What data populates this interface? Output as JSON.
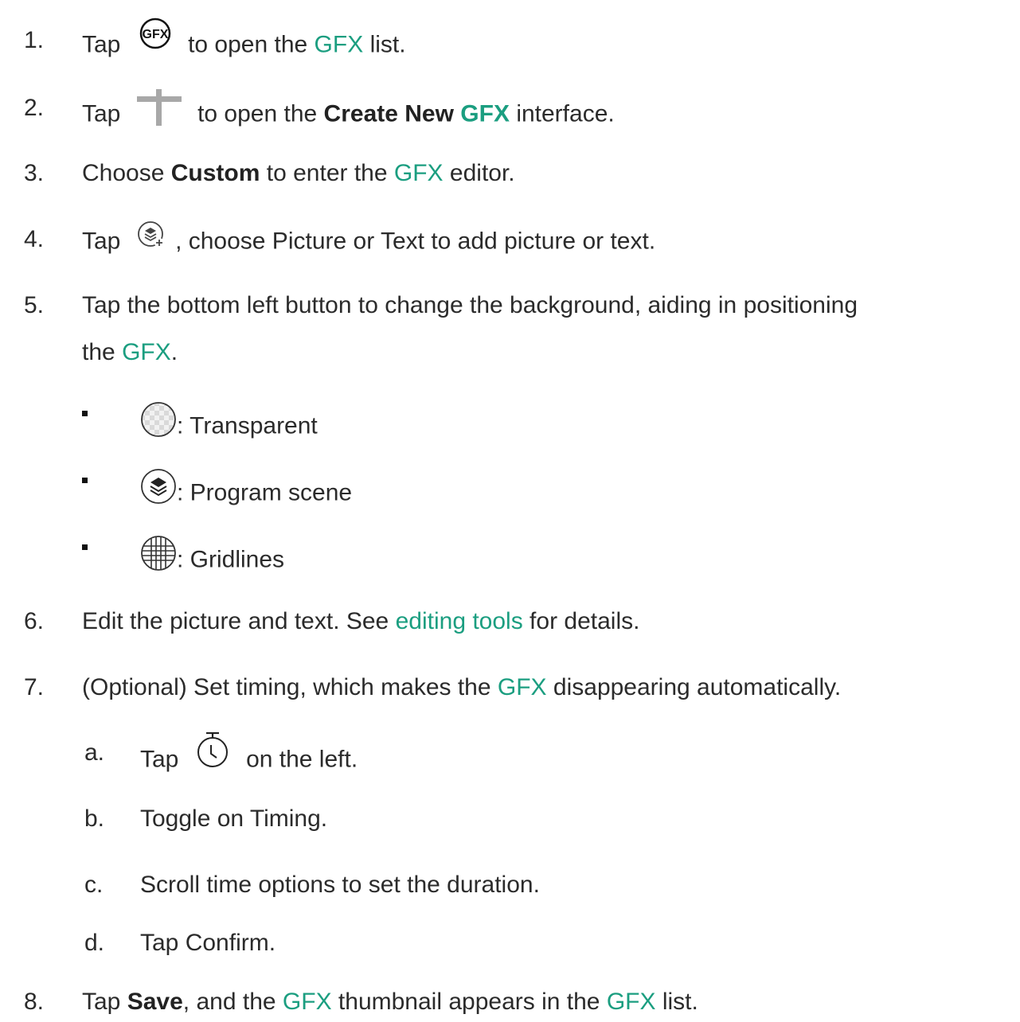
{
  "steps": {
    "s1": {
      "num": "1.",
      "a": "Tap",
      "b": "to open the",
      "link": "GFX",
      "c": "list.",
      "icon": "gfx-icon"
    },
    "s2": {
      "num": "2.",
      "a": "Tap",
      "b": "to open the",
      "bold": "Create New",
      "greenbold": "GFX",
      "c": "interface.",
      "icon": "plus-icon"
    },
    "s3": {
      "num": "3.",
      "a": "Choose",
      "bold": "Custom",
      "b": "to enter the",
      "link": "GFX",
      "c": "editor."
    },
    "s4": {
      "num": "4.",
      "a": "Tap",
      "b": ", choose Picture or Text to add picture or text.",
      "icon": "add-layer-icon"
    },
    "s5": {
      "num": "5.",
      "a": "Tap the bottom left button to change the background, aiding in positioning",
      "b": "the",
      "link": "GFX",
      "c": "."
    },
    "bullets": [
      {
        "text": ": Transparent",
        "icon": "transparent-icon"
      },
      {
        "text": ": Program scene",
        "icon": "program-scene-icon"
      },
      {
        "text": ": Gridlines",
        "icon": "gridlines-icon"
      }
    ],
    "s6": {
      "num": "6.",
      "a": "Edit the picture and text. See",
      "link": "editing tools",
      "c": "for details."
    },
    "s7": {
      "num": "7.",
      "a": "(Optional) Set timing, which makes the",
      "link": "GFX",
      "c": "disappearing automatically."
    },
    "sub": [
      {
        "letter": "a.",
        "a": "Tap",
        "c": "on the left.",
        "icon": "timer-icon"
      },
      {
        "letter": "b.",
        "text": "Toggle on Timing."
      },
      {
        "letter": "c.",
        "text": "Scroll time options to set the duration."
      },
      {
        "letter": "d.",
        "text": "Tap Confirm."
      }
    ],
    "s8": {
      "num": "8.",
      "a": "Tap",
      "bold": "Save",
      "b": ", and the",
      "link1": "GFX",
      "c": "thumbnail appears in the",
      "link2": "GFX",
      "d": "list."
    }
  }
}
